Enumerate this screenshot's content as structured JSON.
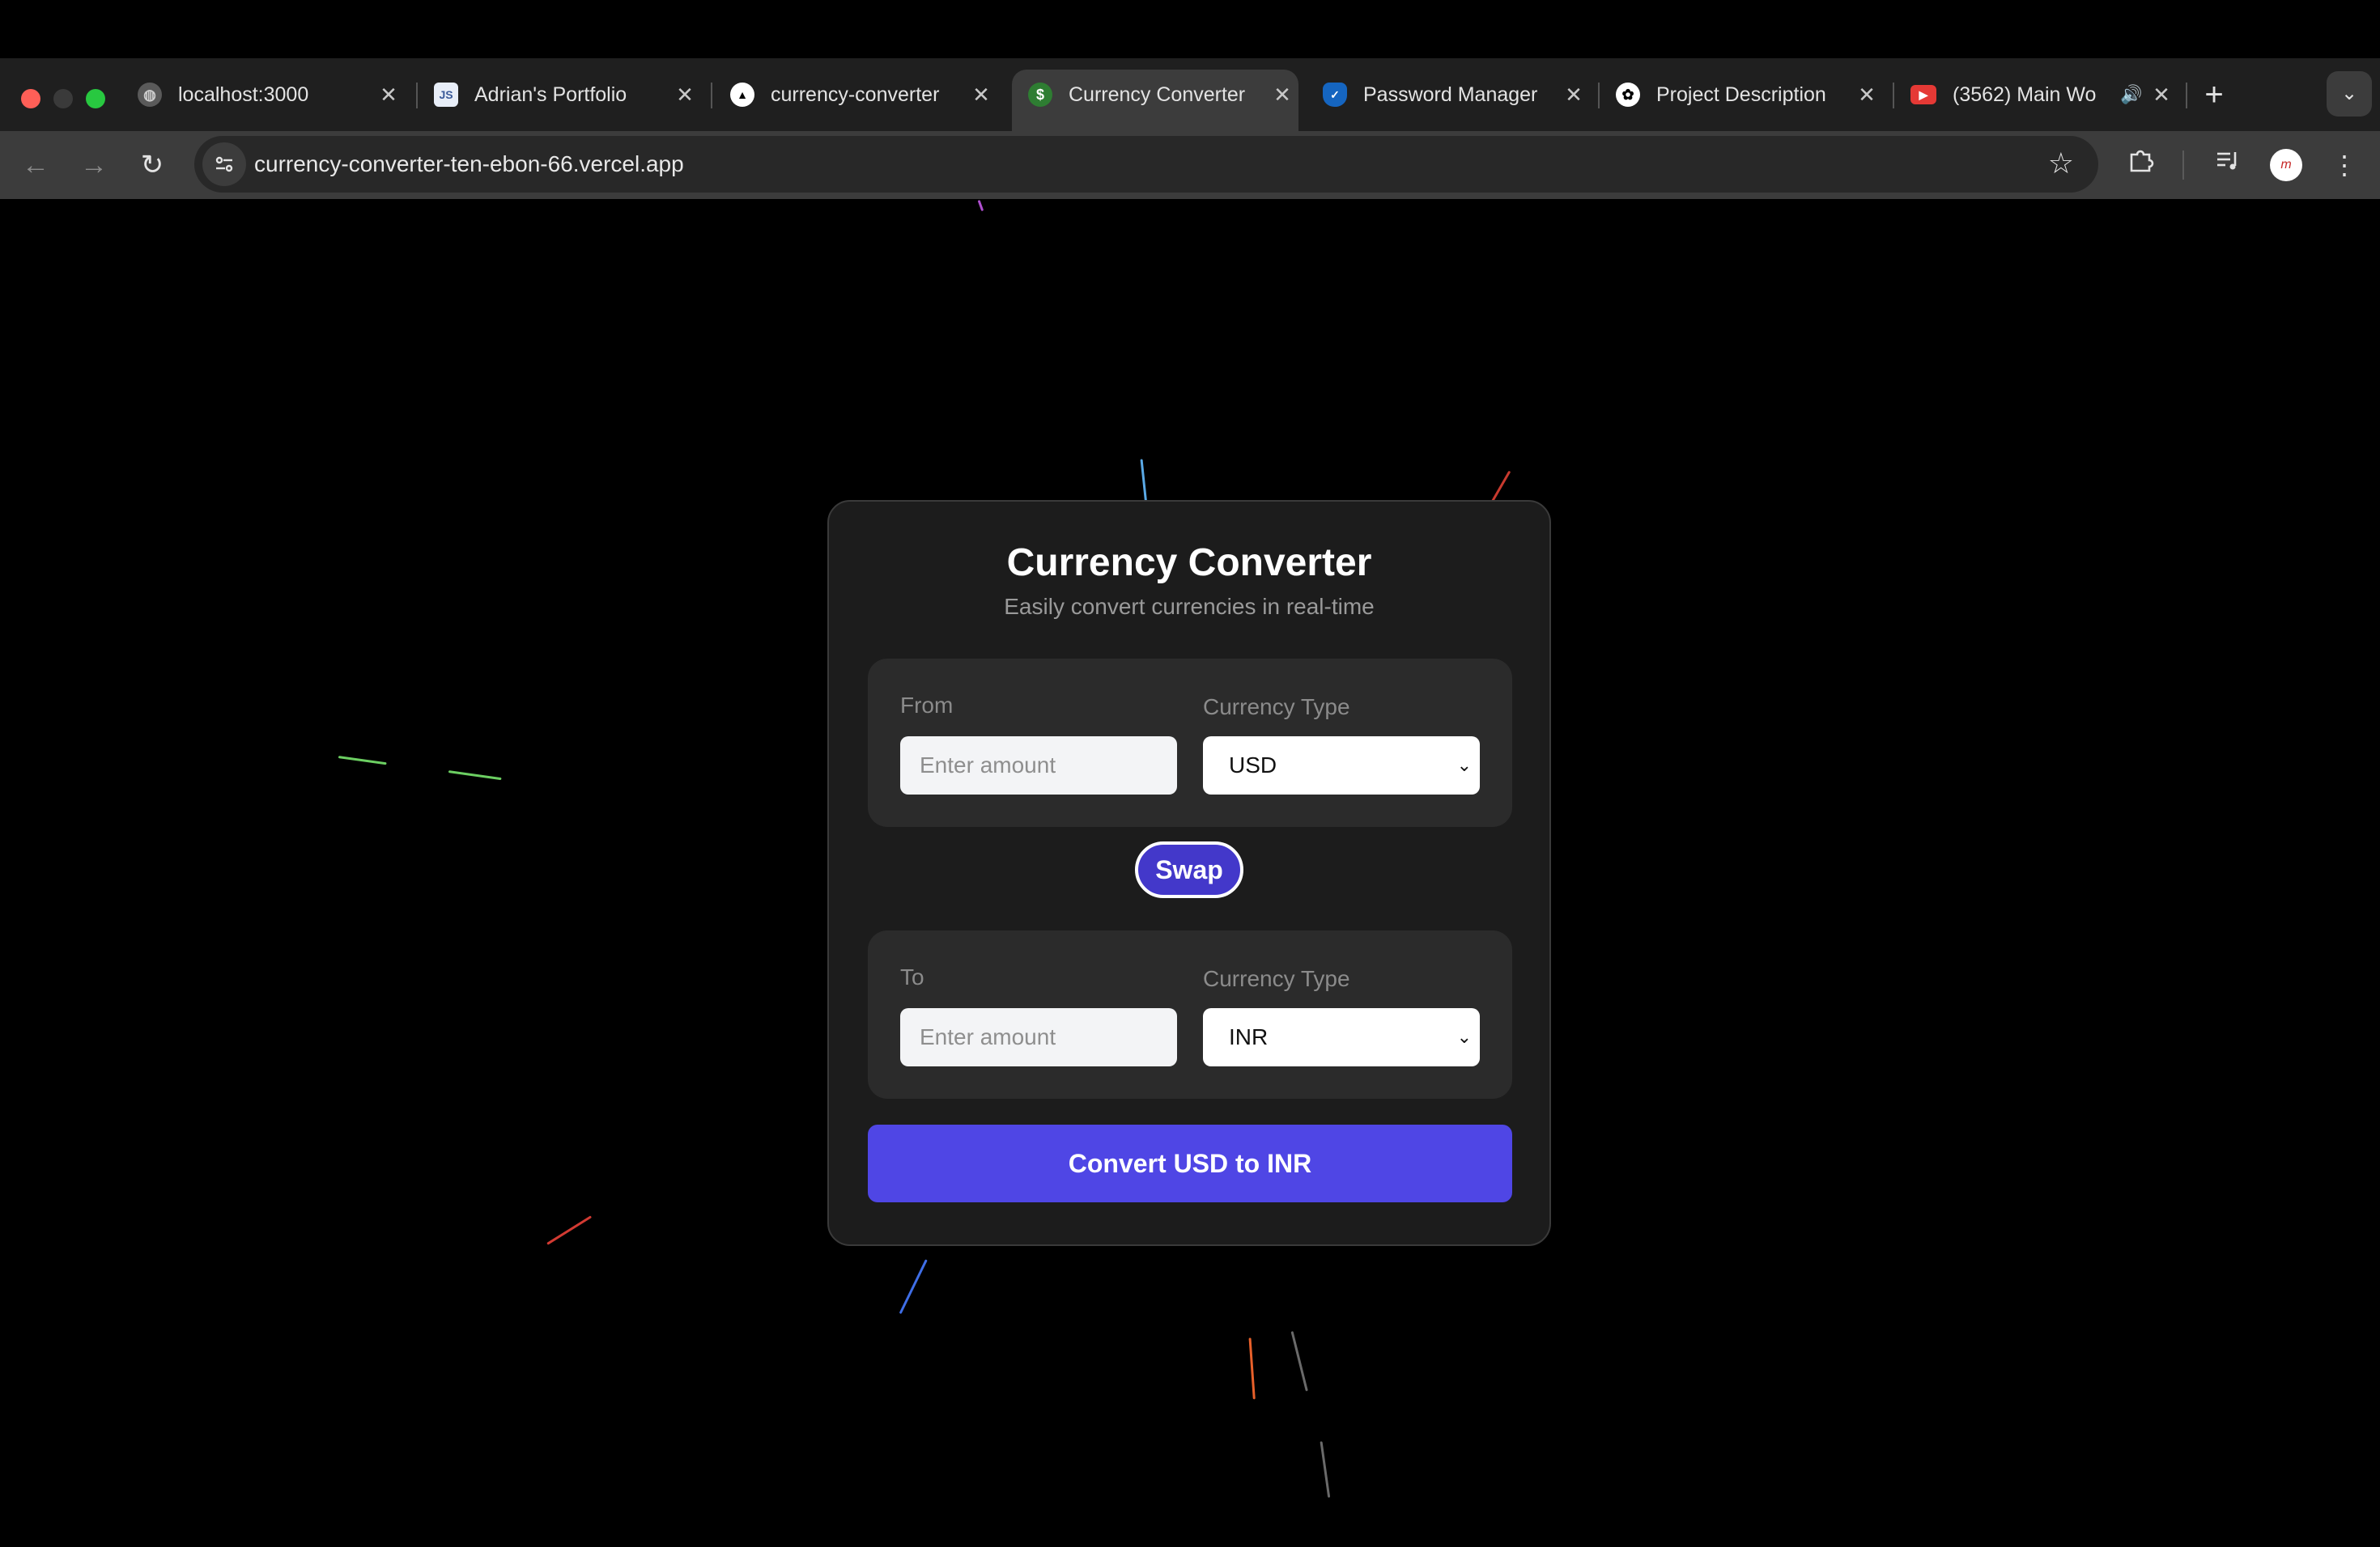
{
  "browser": {
    "tabs": [
      {
        "title": "localhost:3000",
        "favicon": "globe-icon",
        "active": false
      },
      {
        "title": "Adrian's Portfolio",
        "favicon": "portfolio-icon",
        "active": false
      },
      {
        "title": "currency-converter",
        "favicon": "vercel-icon",
        "active": false
      },
      {
        "title": "Currency Converter",
        "favicon": "currency-icon",
        "active": true
      },
      {
        "title": "Password Manager",
        "favicon": "shield-icon",
        "active": false
      },
      {
        "title": "Project Description",
        "favicon": "openai-icon",
        "active": false
      },
      {
        "title": "(3562) Main Wo",
        "favicon": "youtube-icon",
        "active": false
      }
    ],
    "url": "currency-converter-ten-ebon-66.vercel.app"
  },
  "converter": {
    "title": "Currency Converter",
    "subtitle": "Easily convert currencies in real-time",
    "from": {
      "label": "From",
      "placeholder": "Enter amount",
      "currency_label": "Currency Type",
      "currency": "USD"
    },
    "swap_label": "Swap",
    "to": {
      "label": "To",
      "placeholder": "Enter amount",
      "currency_label": "Currency Type",
      "currency": "INR"
    },
    "convert_label": "Convert USD to INR"
  },
  "colors": {
    "accent": "#4f46e5",
    "swap": "#4338ca",
    "card": "#1c1c1c",
    "panel": "#2b2b2b"
  }
}
